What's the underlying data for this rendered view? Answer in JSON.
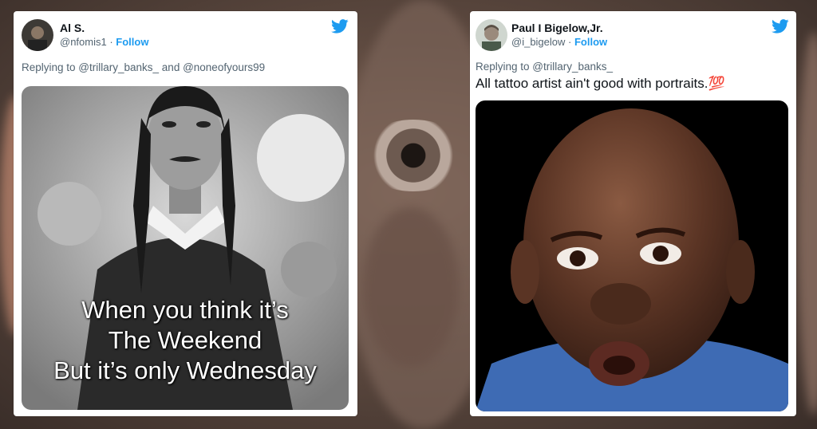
{
  "tweets": [
    {
      "display_name": "Al S.",
      "handle": "@nfomis1",
      "separator": " · ",
      "follow_label": "Follow",
      "reply_prefix": "Replying to ",
      "reply_mention_1": "@trillary_banks_",
      "reply_joiner": " and ",
      "reply_mention_2": "@noneofyours99",
      "text": "",
      "media_caption_lines": [
        "When you think it’s",
        "The Weekend",
        "But it’s only Wednesday"
      ]
    },
    {
      "display_name": "Paul I Bigelow,Jr.",
      "handle": "@i_bigelow",
      "separator": " · ",
      "follow_label": "Follow",
      "reply_prefix": "Replying to ",
      "reply_mention_1": "@trillary_banks_",
      "text": "All tattoo artist ain't good with portraits.",
      "emoji": "💯"
    }
  ],
  "colors": {
    "accent": "#1d9bf0",
    "text_primary": "#0f1419",
    "text_secondary": "#536471"
  },
  "icons": {
    "brand": "twitter-bird-icon"
  }
}
